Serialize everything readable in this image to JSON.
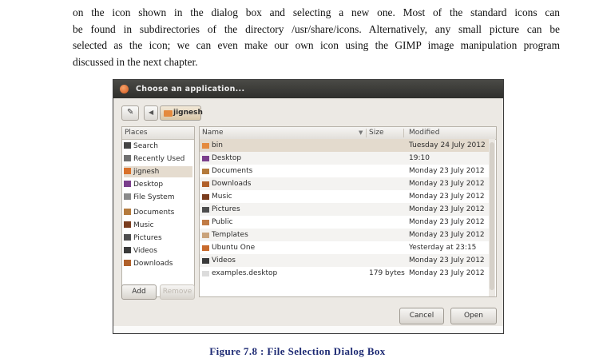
{
  "paragraph": {
    "lines": [
      "on the icon shown in the dialog box and selecting a new one. Most of the standard icons can",
      "be found in subdirectories of the directory /usr/share/icons. Alternatively, any small picture can be",
      "selected as the icon; we can even make our own icon using the GIMP image manipulation program",
      "discussed in the next chapter."
    ]
  },
  "dialog": {
    "title": "Choose an application...",
    "breadcrumb": "jignesh",
    "places_header": "Places",
    "places": [
      {
        "label": "Search",
        "icon": "search-icon",
        "color": "#444444"
      },
      {
        "label": "Recently Used",
        "icon": "clock-icon",
        "color": "#6f6f6f"
      },
      {
        "label": "jignesh",
        "icon": "home-folder-icon",
        "color": "#d9722c"
      },
      {
        "label": "Desktop",
        "icon": "desktop-icon",
        "color": "#7b3f8c"
      },
      {
        "label": "File System",
        "icon": "drive-icon",
        "color": "#8a8a8a"
      },
      {
        "label": "Documents",
        "icon": "documents-folder-icon",
        "color": "#b47a3c"
      },
      {
        "label": "Music",
        "icon": "music-folder-icon",
        "color": "#7a3d1e"
      },
      {
        "label": "Pictures",
        "icon": "pictures-folder-icon",
        "color": "#4e4e4e"
      },
      {
        "label": "Videos",
        "icon": "videos-folder-icon",
        "color": "#3a3a3a"
      },
      {
        "label": "Downloads",
        "icon": "downloads-folder-icon",
        "color": "#b0602a"
      }
    ],
    "columns": {
      "name": "Name",
      "size": "Size",
      "modified": "Modified"
    },
    "files": [
      {
        "name": "bin",
        "size": "",
        "modified": "Tuesday 24 July 2012",
        "icon": "folder-icon",
        "color": "#e48a3e"
      },
      {
        "name": "Desktop",
        "size": "",
        "modified": "19:10",
        "icon": "desktop-icon",
        "color": "#7b3f8c"
      },
      {
        "name": "Documents",
        "size": "",
        "modified": "Monday 23 July 2012",
        "icon": "documents-folder-icon",
        "color": "#b47a3c"
      },
      {
        "name": "Downloads",
        "size": "",
        "modified": "Monday 23 July 2012",
        "icon": "downloads-folder-icon",
        "color": "#b0602a"
      },
      {
        "name": "Music",
        "size": "",
        "modified": "Monday 23 July 2012",
        "icon": "music-folder-icon",
        "color": "#7a3d1e"
      },
      {
        "name": "Pictures",
        "size": "",
        "modified": "Monday 23 July 2012",
        "icon": "pictures-folder-icon",
        "color": "#4e4e4e"
      },
      {
        "name": "Public",
        "size": "",
        "modified": "Monday 23 July 2012",
        "icon": "public-folder-icon",
        "color": "#c07b45"
      },
      {
        "name": "Templates",
        "size": "",
        "modified": "Monday 23 July 2012",
        "icon": "templates-folder-icon",
        "color": "#c9a27a"
      },
      {
        "name": "Ubuntu One",
        "size": "",
        "modified": "Yesterday at 23:15",
        "icon": "ubuntu-one-folder-icon",
        "color": "#c86a2c"
      },
      {
        "name": "Videos",
        "size": "",
        "modified": "Monday 23 July 2012",
        "icon": "videos-folder-icon",
        "color": "#3a3a3a"
      },
      {
        "name": "examples.desktop",
        "size": "179 bytes",
        "modified": "Monday 23 July 2012",
        "icon": "file-icon",
        "color": "#dcdcdc"
      }
    ],
    "buttons": {
      "add": "Add",
      "remove": "Remove",
      "cancel": "Cancel",
      "open": "Open"
    }
  },
  "caption": "Figure 7.8 : File Selection Dialog Box"
}
